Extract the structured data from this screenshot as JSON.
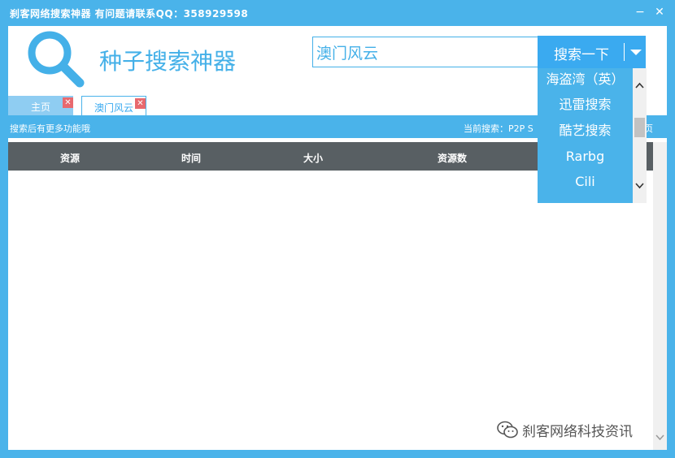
{
  "window": {
    "title": "刹客网络搜索神器  有问题请联系QQ：358929598",
    "minimize_glyph": "−",
    "close_glyph": "✕"
  },
  "header": {
    "app_name": "种子搜索神器",
    "logo_icon": "magnifier-icon"
  },
  "search": {
    "value": "澳门风云",
    "button_label": "搜索一下",
    "dropdown_icon": "caret-down-icon"
  },
  "tabs": [
    {
      "label": "主页",
      "close_glyph": "✕"
    },
    {
      "label": "澳门风云",
      "close_glyph": "✕"
    }
  ],
  "infobar": {
    "tip": "搜索后有更多功能哦",
    "current_search": "当前搜索：P2P S",
    "page_fragment": "页"
  },
  "table": {
    "columns": [
      "资源",
      "时间",
      "大小",
      "资源数"
    ]
  },
  "dropdown": {
    "items": [
      "海盗湾（英）",
      "迅雷搜索",
      "酷艺搜索",
      "Rarbg",
      "Cili"
    ]
  },
  "watermark": {
    "text": "刹客网络科技资讯"
  },
  "colors": {
    "accent": "#4ab3ea",
    "table_header": "#585f63",
    "tab_close": "#e8696e"
  }
}
